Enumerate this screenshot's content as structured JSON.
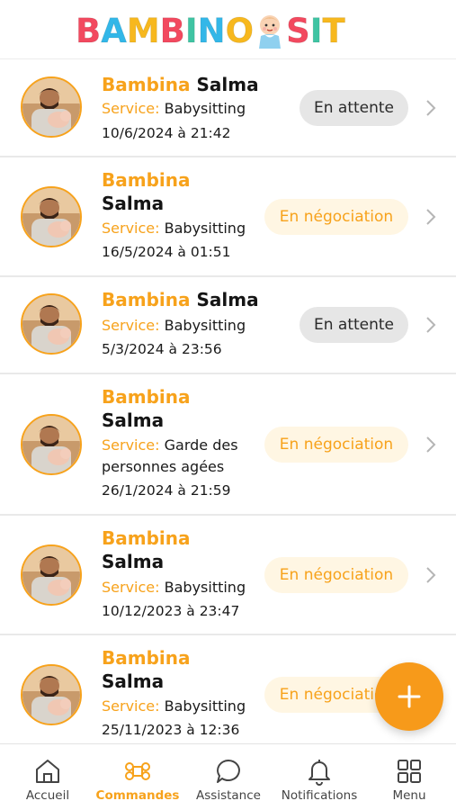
{
  "app": {
    "logo_text": "BAMBINO SIT",
    "logo_letters": [
      {
        "ch": "B",
        "color": "#f2495f"
      },
      {
        "ch": "A",
        "color": "#33b7e8"
      },
      {
        "ch": "M",
        "color": "#f7b81e"
      },
      {
        "ch": "B",
        "color": "#f2495f"
      },
      {
        "ch": "I",
        "color": "#3fc4a3"
      },
      {
        "ch": "N",
        "color": "#33b7e8"
      },
      {
        "ch": "O",
        "color": "#f7b81e"
      }
    ],
    "logo_tail": [
      {
        "ch": "S",
        "color": "#f2495f"
      },
      {
        "ch": "I",
        "color": "#3fc4a3"
      },
      {
        "ch": "T",
        "color": "#f7b81e"
      }
    ]
  },
  "orders": [
    {
      "first": "Bambina",
      "last": "Salma",
      "service_label": "Service:",
      "service": "Babysitting",
      "date": "10/6/2024 à 21:42",
      "status": "En attente",
      "status_kind": "wait"
    },
    {
      "first": "Bambina",
      "last": "Salma",
      "service_label": "Service:",
      "service": "Babysitting",
      "date": "16/5/2024 à 01:51",
      "status": "En négociation",
      "status_kind": "nego"
    },
    {
      "first": "Bambina",
      "last": "Salma",
      "service_label": "Service:",
      "service": "Babysitting",
      "date": "5/3/2024 à 23:56",
      "status": "En attente",
      "status_kind": "wait"
    },
    {
      "first": "Bambina",
      "last": "Salma",
      "service_label": "Service:",
      "service": "Garde des personnes agées",
      "date": "26/1/2024 à 21:59",
      "status": "En négociation",
      "status_kind": "nego"
    },
    {
      "first": "Bambina",
      "last": "Salma",
      "service_label": "Service:",
      "service": "Babysitting",
      "date": "10/12/2023 à 23:47",
      "status": "En négociation",
      "status_kind": "nego"
    },
    {
      "first": "Bambina",
      "last": "Salma",
      "service_label": "Service:",
      "service": "Babysitting",
      "date": "25/11/2023 à 12:36",
      "status": "En négociation",
      "status_kind": "nego"
    }
  ],
  "fab": {
    "icon": "plus-icon"
  },
  "nav": [
    {
      "label": "Accueil",
      "icon": "home-icon",
      "active": false
    },
    {
      "label": "Commandes",
      "icon": "command-icon",
      "active": true
    },
    {
      "label": "Assistance",
      "icon": "chat-bubble-icon",
      "active": false
    },
    {
      "label": "Notifications",
      "icon": "bell-icon",
      "active": false
    },
    {
      "label": "Menu",
      "icon": "grid-icon",
      "active": false
    }
  ],
  "colors": {
    "accent": "#f7a21b",
    "badge_wait_bg": "#e6e6e6",
    "badge_nego_bg": "#fff6e3"
  }
}
